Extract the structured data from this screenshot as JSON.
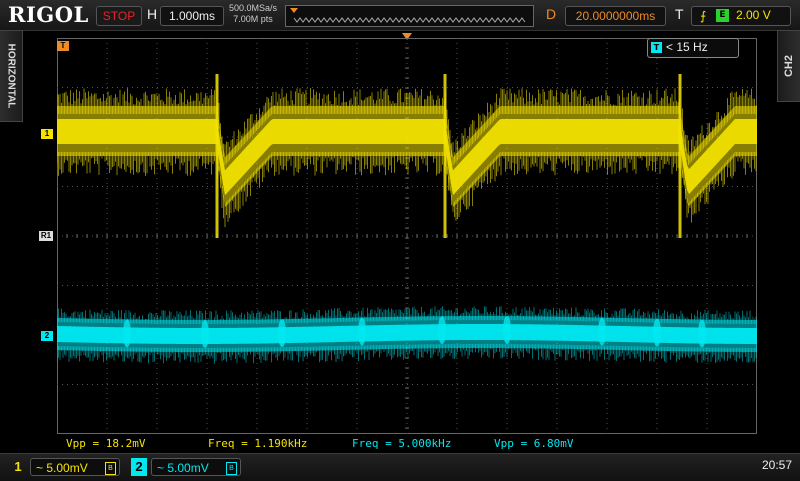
{
  "brand": "RIGOL",
  "run_state": "STOP",
  "timebase": {
    "label": "H",
    "value": "1.000ms"
  },
  "sample": {
    "rate": "500.0MSa/s",
    "points": "7.00M pts"
  },
  "delay": {
    "label": "D",
    "value": "20.0000000ms"
  },
  "trigger": {
    "label": "T",
    "edge_icon": "rising-edge-icon",
    "coupling_icon": "E",
    "level": "2.00 V"
  },
  "side_tabs": {
    "left": "HORIZONTAL",
    "right": "CH2"
  },
  "markers": {
    "trigger": "T",
    "ch1": "1",
    "ref": "R1",
    "ch2": "2"
  },
  "filter": {
    "icon": "T",
    "text": "< 15 Hz"
  },
  "measurements": [
    {
      "text": "Vpp = 18.2mV",
      "color": "#f5e400"
    },
    {
      "text": "Freq = 1.190kHz",
      "color": "#f5e400"
    },
    {
      "text": "Freq = 5.000kHz",
      "color": "#00e8f0"
    },
    {
      "text": "Vpp = 6.80mV",
      "color": "#00e8f0"
    }
  ],
  "channels": [
    {
      "number": "1",
      "coupling": "~",
      "scale": "5.00mV",
      "impedance_icon": "B",
      "color": "#f5e400"
    },
    {
      "number": "2",
      "coupling": "~",
      "scale": "5.00mV",
      "impedance_icon": "B",
      "color": "#00e8f0"
    }
  ],
  "clock": "20:57",
  "colors": {
    "ch1": "#f5e400",
    "ch2": "#00e8f0",
    "delay": "#f08a24",
    "stop": "#e8232a"
  }
}
